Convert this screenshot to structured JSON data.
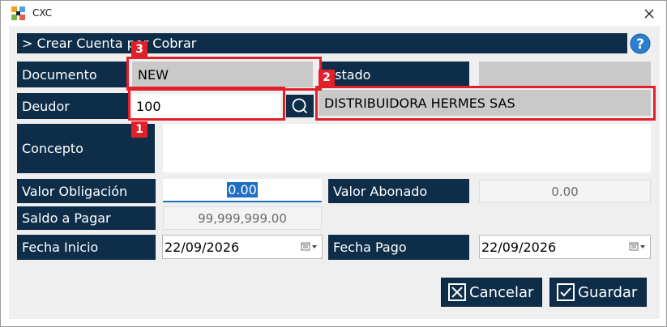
{
  "window": {
    "title": "CXC"
  },
  "header": {
    "title": "> Crear Cuenta por Cobrar"
  },
  "form": {
    "documento_label": "Documento",
    "documento_value": "NEW",
    "estado_label": "Estado",
    "estado_value": "",
    "deudor_label": "Deudor",
    "deudor_value": "100",
    "deudor_name": "DISTRIBUIDORA HERMES SAS",
    "concepto_label": "Concepto",
    "concepto_value": "",
    "valor_obligacion_label": "Valor Obligación",
    "valor_obligacion_value": "0.00",
    "valor_abonado_label": "Valor Abonado",
    "valor_abonado_value": "0.00",
    "saldo_label": "Saldo a Pagar",
    "saldo_value": "99,999,999.00",
    "fecha_inicio_label": "Fecha Inicio",
    "fecha_inicio_value": "22/09/2026",
    "fecha_pago_label": "Fecha Pago",
    "fecha_pago_value": "22/09/2026"
  },
  "buttons": {
    "cancel": "Cancelar",
    "save": "Guardar"
  },
  "annotations": {
    "one": "1",
    "two": "2",
    "three": "3"
  },
  "colors": {
    "accent": "#0e2d49",
    "annotation": "#e3202a",
    "readonly": "#c9c9c9"
  }
}
